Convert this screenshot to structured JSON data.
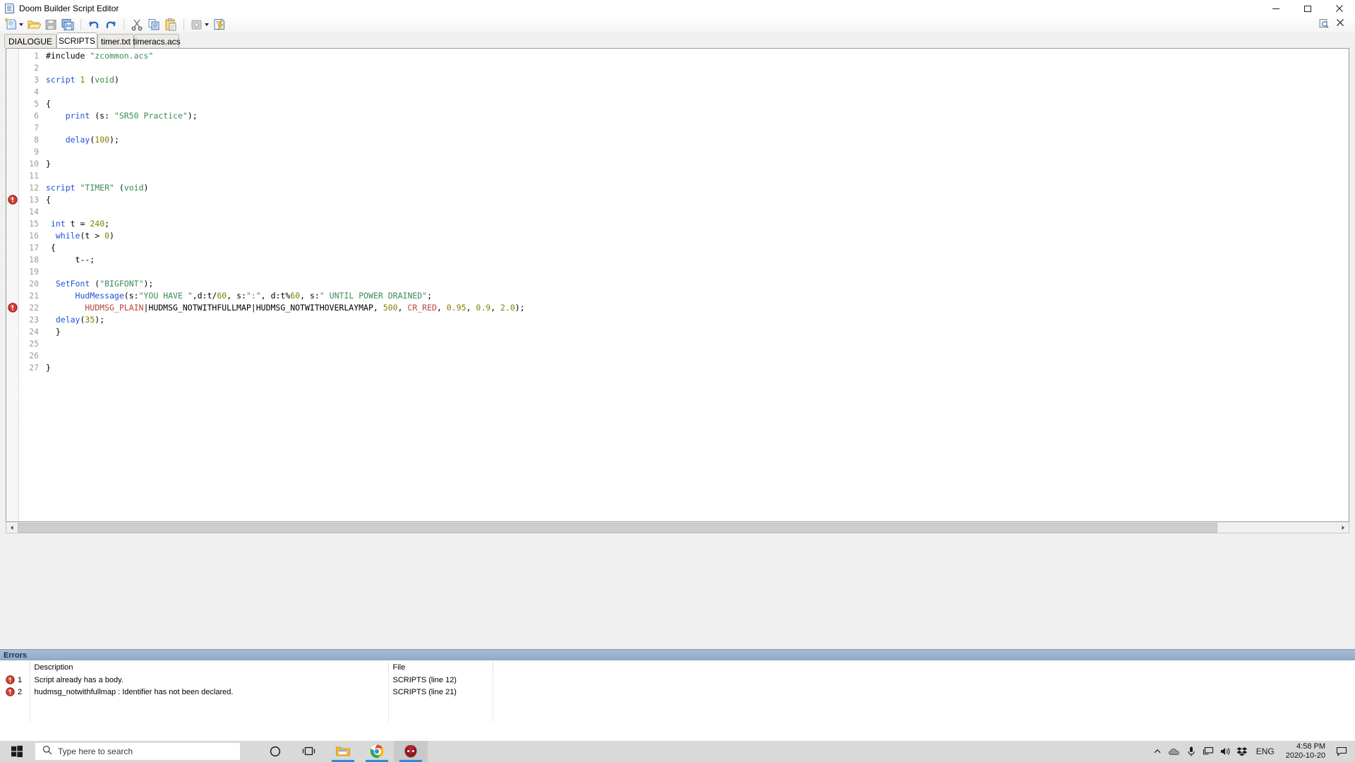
{
  "window": {
    "title": "Doom Builder Script Editor",
    "icon": "script-document-icon",
    "minimize_label": "Minimize",
    "maximize_label": "Maximize",
    "close_label": "Close"
  },
  "toolbar": {
    "items": [
      {
        "name": "new-script-button",
        "label": "New Script",
        "icon": "new-document-icon",
        "has_dropdown": true
      },
      {
        "name": "open-script-button",
        "label": "Open Script",
        "icon": "open-folder-icon"
      },
      {
        "name": "save-script-button",
        "label": "Save Script",
        "icon": "save-disk-icon"
      },
      {
        "name": "save-all-button",
        "label": "Save All",
        "icon": "save-all-icon"
      },
      {
        "name": "undo-button",
        "label": "Undo",
        "icon": "undo-arrow-icon"
      },
      {
        "name": "redo-button",
        "label": "Redo",
        "icon": "redo-arrow-icon"
      },
      {
        "name": "cut-button",
        "label": "Cut",
        "icon": "scissors-icon"
      },
      {
        "name": "copy-button",
        "label": "Copy",
        "icon": "copy-icon"
      },
      {
        "name": "paste-button",
        "label": "Paste",
        "icon": "clipboard-paste-icon"
      },
      {
        "name": "compile-button",
        "label": "Compile Script",
        "icon": "compile-icon",
        "has_dropdown": true
      },
      {
        "name": "run-script-button",
        "label": "Run Script",
        "icon": "lightning-script-icon"
      }
    ],
    "right_items": [
      {
        "name": "find-replace-button",
        "label": "Find and Replace",
        "icon": "find-replace-icon"
      },
      {
        "name": "close-tab-button",
        "label": "Close",
        "icon": "close-x-icon"
      }
    ]
  },
  "tabs": [
    {
      "label": "DIALOGUE",
      "active": false
    },
    {
      "label": "SCRIPTS",
      "active": true
    },
    {
      "label": "timer.txt",
      "active": false
    },
    {
      "label": "timeracs.acs",
      "active": false
    }
  ],
  "editor": {
    "language": "ACS",
    "error_marker_icon": "error-circle-icon",
    "error_marker_lines": [
      13,
      22
    ],
    "lines": [
      {
        "n": 1,
        "tokens": [
          {
            "t": "#include ",
            "c": "pln"
          },
          {
            "t": "\"zcommon.acs\"",
            "c": "str"
          }
        ]
      },
      {
        "n": 2,
        "tokens": []
      },
      {
        "n": 3,
        "tokens": [
          {
            "t": "script",
            "c": "kw"
          },
          {
            "t": " ",
            "c": "pln"
          },
          {
            "t": "1",
            "c": "num"
          },
          {
            "t": " (",
            "c": "pln"
          },
          {
            "t": "void",
            "c": "ty"
          },
          {
            "t": ")",
            "c": "pln"
          }
        ]
      },
      {
        "n": 4,
        "tokens": []
      },
      {
        "n": 5,
        "tokens": [
          {
            "t": "{",
            "c": "pln"
          }
        ]
      },
      {
        "n": 6,
        "tokens": [
          {
            "t": "    ",
            "c": "pln"
          },
          {
            "t": "print",
            "c": "kw"
          },
          {
            "t": " (s: ",
            "c": "pln"
          },
          {
            "t": "\"SR50 Practice\"",
            "c": "str"
          },
          {
            "t": ");",
            "c": "pln"
          }
        ]
      },
      {
        "n": 7,
        "tokens": []
      },
      {
        "n": 8,
        "tokens": [
          {
            "t": "    ",
            "c": "pln"
          },
          {
            "t": "delay",
            "c": "kw"
          },
          {
            "t": "(",
            "c": "pln"
          },
          {
            "t": "100",
            "c": "num"
          },
          {
            "t": ");",
            "c": "pln"
          }
        ]
      },
      {
        "n": 9,
        "tokens": []
      },
      {
        "n": 10,
        "tokens": [
          {
            "t": "}",
            "c": "pln"
          }
        ]
      },
      {
        "n": 11,
        "tokens": []
      },
      {
        "n": 12,
        "tokens": [
          {
            "t": "script",
            "c": "kw"
          },
          {
            "t": " ",
            "c": "pln"
          },
          {
            "t": "\"TIMER\"",
            "c": "str"
          },
          {
            "t": " (",
            "c": "pln"
          },
          {
            "t": "void",
            "c": "ty"
          },
          {
            "t": ")",
            "c": "pln"
          }
        ]
      },
      {
        "n": 13,
        "tokens": [
          {
            "t": "{",
            "c": "pln"
          }
        ]
      },
      {
        "n": 14,
        "tokens": []
      },
      {
        "n": 15,
        "tokens": [
          {
            "t": " ",
            "c": "pln"
          },
          {
            "t": "int",
            "c": "kw"
          },
          {
            "t": " t = ",
            "c": "pln"
          },
          {
            "t": "240",
            "c": "num"
          },
          {
            "t": ";",
            "c": "pln"
          }
        ]
      },
      {
        "n": 16,
        "tokens": [
          {
            "t": "  ",
            "c": "pln"
          },
          {
            "t": "while",
            "c": "kw"
          },
          {
            "t": "(t > ",
            "c": "pln"
          },
          {
            "t": "0",
            "c": "num"
          },
          {
            "t": ")",
            "c": "pln"
          }
        ]
      },
      {
        "n": 17,
        "tokens": [
          {
            "t": " {",
            "c": "pln"
          }
        ]
      },
      {
        "n": 18,
        "tokens": [
          {
            "t": "      t--;",
            "c": "pln"
          }
        ]
      },
      {
        "n": 19,
        "tokens": []
      },
      {
        "n": 20,
        "tokens": [
          {
            "t": "  ",
            "c": "pln"
          },
          {
            "t": "SetFont",
            "c": "kw"
          },
          {
            "t": " (",
            "c": "pln"
          },
          {
            "t": "\"BIGFONT\"",
            "c": "str"
          },
          {
            "t": ");",
            "c": "pln"
          }
        ]
      },
      {
        "n": 21,
        "tokens": [
          {
            "t": "      ",
            "c": "pln"
          },
          {
            "t": "HudMessage",
            "c": "kw"
          },
          {
            "t": "(s:",
            "c": "pln"
          },
          {
            "t": "\"YOU HAVE \"",
            "c": "str"
          },
          {
            "t": ",d:t/",
            "c": "pln"
          },
          {
            "t": "60",
            "c": "num"
          },
          {
            "t": ", s:",
            "c": "pln"
          },
          {
            "t": "\":\"",
            "c": "str"
          },
          {
            "t": ", d:t%",
            "c": "pln"
          },
          {
            "t": "60",
            "c": "num"
          },
          {
            "t": ", s:",
            "c": "pln"
          },
          {
            "t": "\" UNTIL POWER DRAINED\"",
            "c": "str"
          },
          {
            "t": ";",
            "c": "pln"
          }
        ]
      },
      {
        "n": 22,
        "tokens": [
          {
            "t": "        ",
            "c": "pln"
          },
          {
            "t": "HUDMSG_PLAIN",
            "c": "con"
          },
          {
            "t": "|HUDMSG_NOTWITHFULLMAP|HUDMSG_NOTWITHOVERLAYMAP, ",
            "c": "pln"
          },
          {
            "t": "500",
            "c": "num"
          },
          {
            "t": ", ",
            "c": "pln"
          },
          {
            "t": "CR_RED",
            "c": "con"
          },
          {
            "t": ", ",
            "c": "pln"
          },
          {
            "t": "0.95",
            "c": "num"
          },
          {
            "t": ", ",
            "c": "pln"
          },
          {
            "t": "0.9",
            "c": "num"
          },
          {
            "t": ", ",
            "c": "pln"
          },
          {
            "t": "2.0",
            "c": "num"
          },
          {
            "t": ");",
            "c": "pln"
          }
        ]
      },
      {
        "n": 23,
        "tokens": [
          {
            "t": "  ",
            "c": "pln"
          },
          {
            "t": "delay",
            "c": "kw"
          },
          {
            "t": "(",
            "c": "pln"
          },
          {
            "t": "35",
            "c": "num"
          },
          {
            "t": ");",
            "c": "pln"
          }
        ]
      },
      {
        "n": 24,
        "tokens": [
          {
            "t": "  }",
            "c": "pln"
          }
        ]
      },
      {
        "n": 25,
        "tokens": []
      },
      {
        "n": 26,
        "tokens": []
      },
      {
        "n": 27,
        "tokens": [
          {
            "t": "}",
            "c": "pln"
          }
        ]
      }
    ]
  },
  "errors": {
    "panel_title": "Errors",
    "columns": [
      "",
      "Description",
      "File",
      ""
    ],
    "rows": [
      {
        "index": "1",
        "icon": "error-circle-icon",
        "description": "Script already has a body.",
        "file": "SCRIPTS (line 12)"
      },
      {
        "index": "2",
        "icon": "error-circle-icon",
        "description": "hudmsg_notwithfullmap : Identifier has not been declared.",
        "file": "SCRIPTS (line 21)"
      }
    ]
  },
  "taskbar": {
    "start_label": "Start",
    "search_placeholder": "Type here to search",
    "search_icon": "search-icon",
    "buttons": [
      {
        "name": "cortana-button",
        "icon": "cortana-circle-icon",
        "label": "Cortana"
      },
      {
        "name": "task-view-button",
        "icon": "task-view-icon",
        "label": "Task View"
      },
      {
        "name": "file-explorer-button",
        "icon": "file-explorer-icon",
        "label": "File Explorer",
        "running": true
      },
      {
        "name": "chrome-button",
        "icon": "chrome-icon",
        "label": "Google Chrome",
        "running": true
      },
      {
        "name": "doombuilder-button",
        "icon": "doom-builder-icon",
        "label": "Doom Builder",
        "running": true,
        "active": true
      }
    ],
    "tray": [
      {
        "name": "show-hidden-icons-button",
        "icon": "chevron-up-icon"
      },
      {
        "name": "onedrive-icon",
        "icon": "cloud-icon"
      },
      {
        "name": "microphone-icon",
        "icon": "microphone-icon"
      },
      {
        "name": "network-icon",
        "icon": "network-monitor-icon"
      },
      {
        "name": "volume-icon",
        "icon": "speaker-icon"
      },
      {
        "name": "dropbox-icon",
        "icon": "dropbox-icon"
      }
    ],
    "language": "ENG",
    "time": "4:58 PM",
    "date": "2020-10-20",
    "action_center_icon": "notification-icon"
  },
  "colors": {
    "accent": "#2e8ad6",
    "error": "#c0392b",
    "panel_header": "#8fa9c6",
    "keyword": "#1f4fd8",
    "string": "#3d8a5a",
    "number": "#808000",
    "constant": "#b5443b"
  }
}
